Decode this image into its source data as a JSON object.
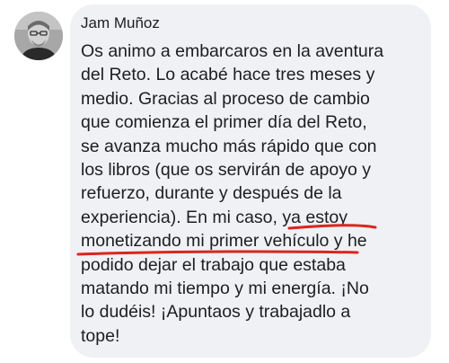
{
  "comment": {
    "author": "Jam Muñoz",
    "text_lines": [
      "Os animo a embarcaros en la aventura",
      "del Reto. Lo acabé hace tres meses y",
      "medio. Gracias al proceso de cambio",
      "que comienza el primer día del Reto,",
      "se avanza mucho más rápido que con",
      "los libros (que os servirán de apoyo y",
      "refuerzo, durante y después de la",
      "experiencia). En mi caso, ya estoy",
      "monetizando mi primer vehículo y he",
      "podido dejar el trabajo que estaba",
      "matando mi tiempo y mi energía. ¡No",
      "lo dudéis! ¡Apuntaos y trabajadlo a",
      "tope!"
    ]
  },
  "colors": {
    "bubble_background": "#eff1f4",
    "text": "#1c1e21",
    "highlight_underline": "#d9261c"
  }
}
